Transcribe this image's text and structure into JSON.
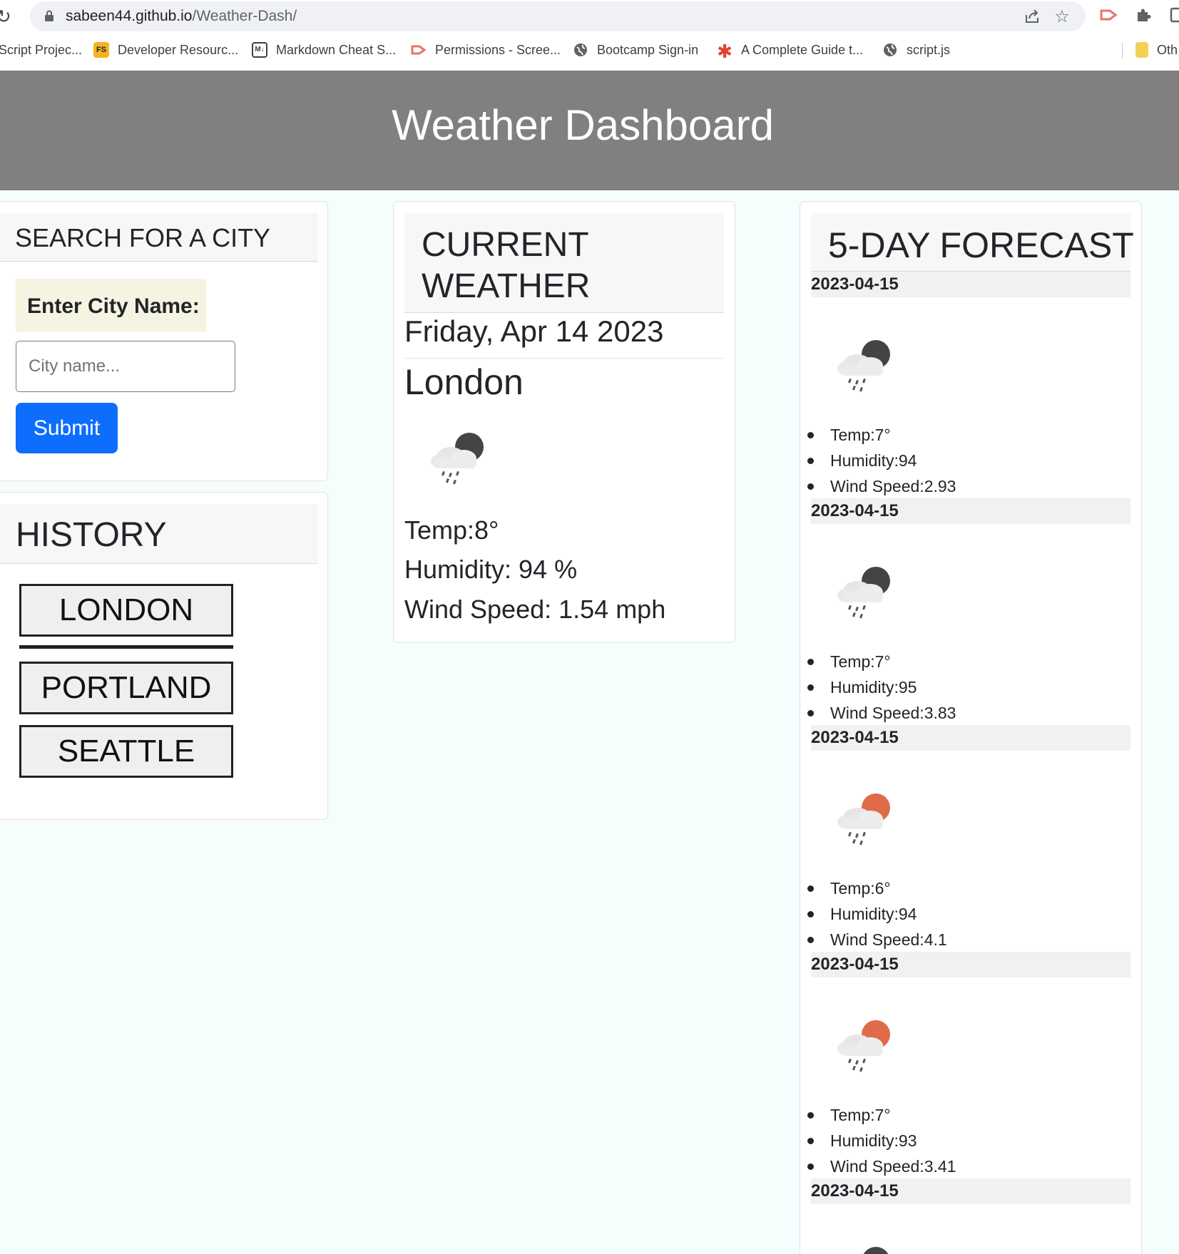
{
  "browser": {
    "url_host": "sabeen44.github.io",
    "url_path": "/Weather-Dash/",
    "bookmarks": [
      {
        "label": "Script Projec...",
        "icon": "page-icon"
      },
      {
        "label": "Developer Resourc...",
        "icon": "fs-logo-icon"
      },
      {
        "label": "Markdown Cheat S...",
        "icon": "markdown-icon"
      },
      {
        "label": "Permissions - Scree...",
        "icon": "screencastify-icon"
      },
      {
        "label": "Bootcamp Sign-in",
        "icon": "globe-icon"
      },
      {
        "label": "A Complete Guide t...",
        "icon": "asterisk-icon"
      },
      {
        "label": "script.js",
        "icon": "globe-icon"
      },
      {
        "label": "Oth",
        "icon": "folder-icon"
      }
    ]
  },
  "header": {
    "title": "Weather Dashboard"
  },
  "search": {
    "title": "SEARCH FOR A CITY",
    "label": "Enter City Name:",
    "placeholder": "City name...",
    "submit_label": "Submit"
  },
  "history": {
    "title": "HISTORY",
    "cities": [
      "LONDON",
      "PORTLAND",
      "SEATTLE"
    ]
  },
  "current": {
    "title": "CURRENT WEATHER",
    "date": "Friday, Apr 14 2023",
    "city": "London",
    "icon": "rain-night-icon",
    "temp": "Temp:8°",
    "humidity": "Humidity: 94 %",
    "wind": "Wind Speed: 1.54 mph"
  },
  "forecast": {
    "title": "5-DAY FORECAST",
    "days": [
      {
        "date": "2023-04-15",
        "icon": "rain-night-icon",
        "temp": "Temp:7°",
        "humidity": "Humidity:94",
        "wind": "Wind Speed:2.93"
      },
      {
        "date": "2023-04-15",
        "icon": "rain-night-icon",
        "temp": "Temp:7°",
        "humidity": "Humidity:95",
        "wind": "Wind Speed:3.83"
      },
      {
        "date": "2023-04-15",
        "icon": "rain-day-icon",
        "temp": "Temp:6°",
        "humidity": "Humidity:94",
        "wind": "Wind Speed:4.1"
      },
      {
        "date": "2023-04-15",
        "icon": "rain-day-icon",
        "temp": "Temp:7°",
        "humidity": "Humidity:93",
        "wind": "Wind Speed:3.41"
      },
      {
        "date": "2023-04-15"
      }
    ]
  },
  "colors": {
    "header_bg": "#808080",
    "page_bg": "#f5fdfd",
    "submit_bg": "#0d6efd",
    "label_bg": "#f5f3e1",
    "moon_dark": "#444444",
    "sun_orange": "#e06b4b"
  }
}
